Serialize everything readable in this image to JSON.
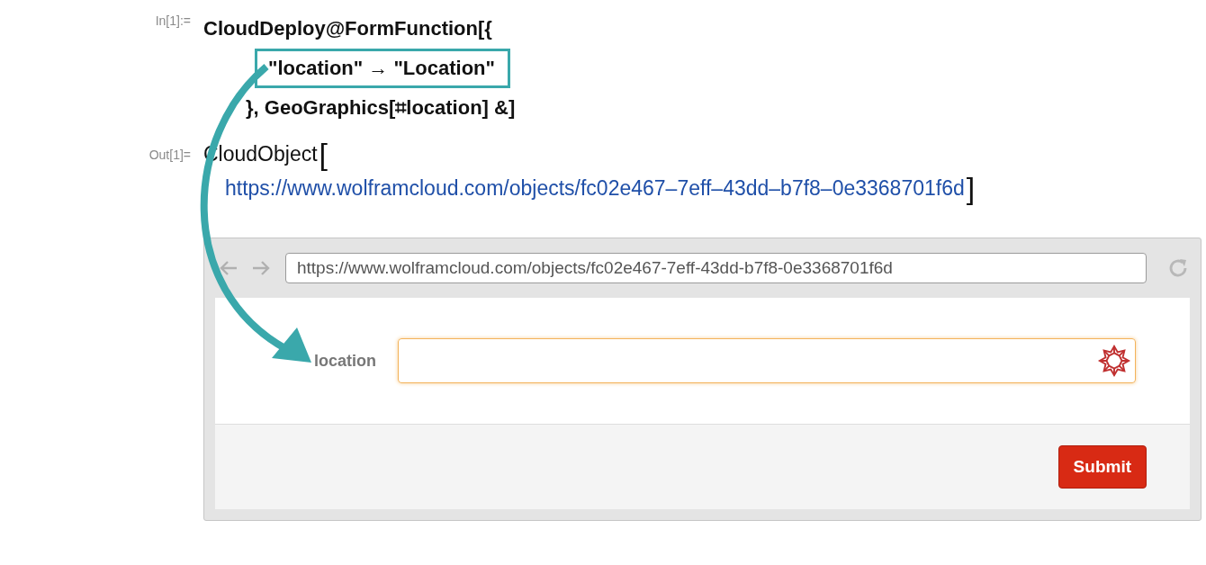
{
  "input_cell": {
    "label": "In[1]:=",
    "lines": [
      {
        "text": "CloudDeploy@FormFunction[{",
        "boxed": false
      },
      {
        "text": "\"location\" → \"Location\"",
        "boxed": true
      },
      {
        "text": "}, GeoGraphics[⌗location] &]",
        "boxed": false
      }
    ]
  },
  "output_cell": {
    "label": "Out[1]=",
    "head": "CloudObject",
    "open_bracket": "[",
    "link": "https://www.wolframcloud.com/objects/fc02e467–7eff–43dd–b7f8–0e3368701f6d",
    "close_bracket": "]"
  },
  "browser": {
    "address": "https://www.wolframcloud.com/objects/fc02e467-7eff-43dd-b7f8-0e3368701f6d",
    "form": {
      "field_label": "location",
      "focused": true,
      "submit": "Submit"
    }
  }
}
